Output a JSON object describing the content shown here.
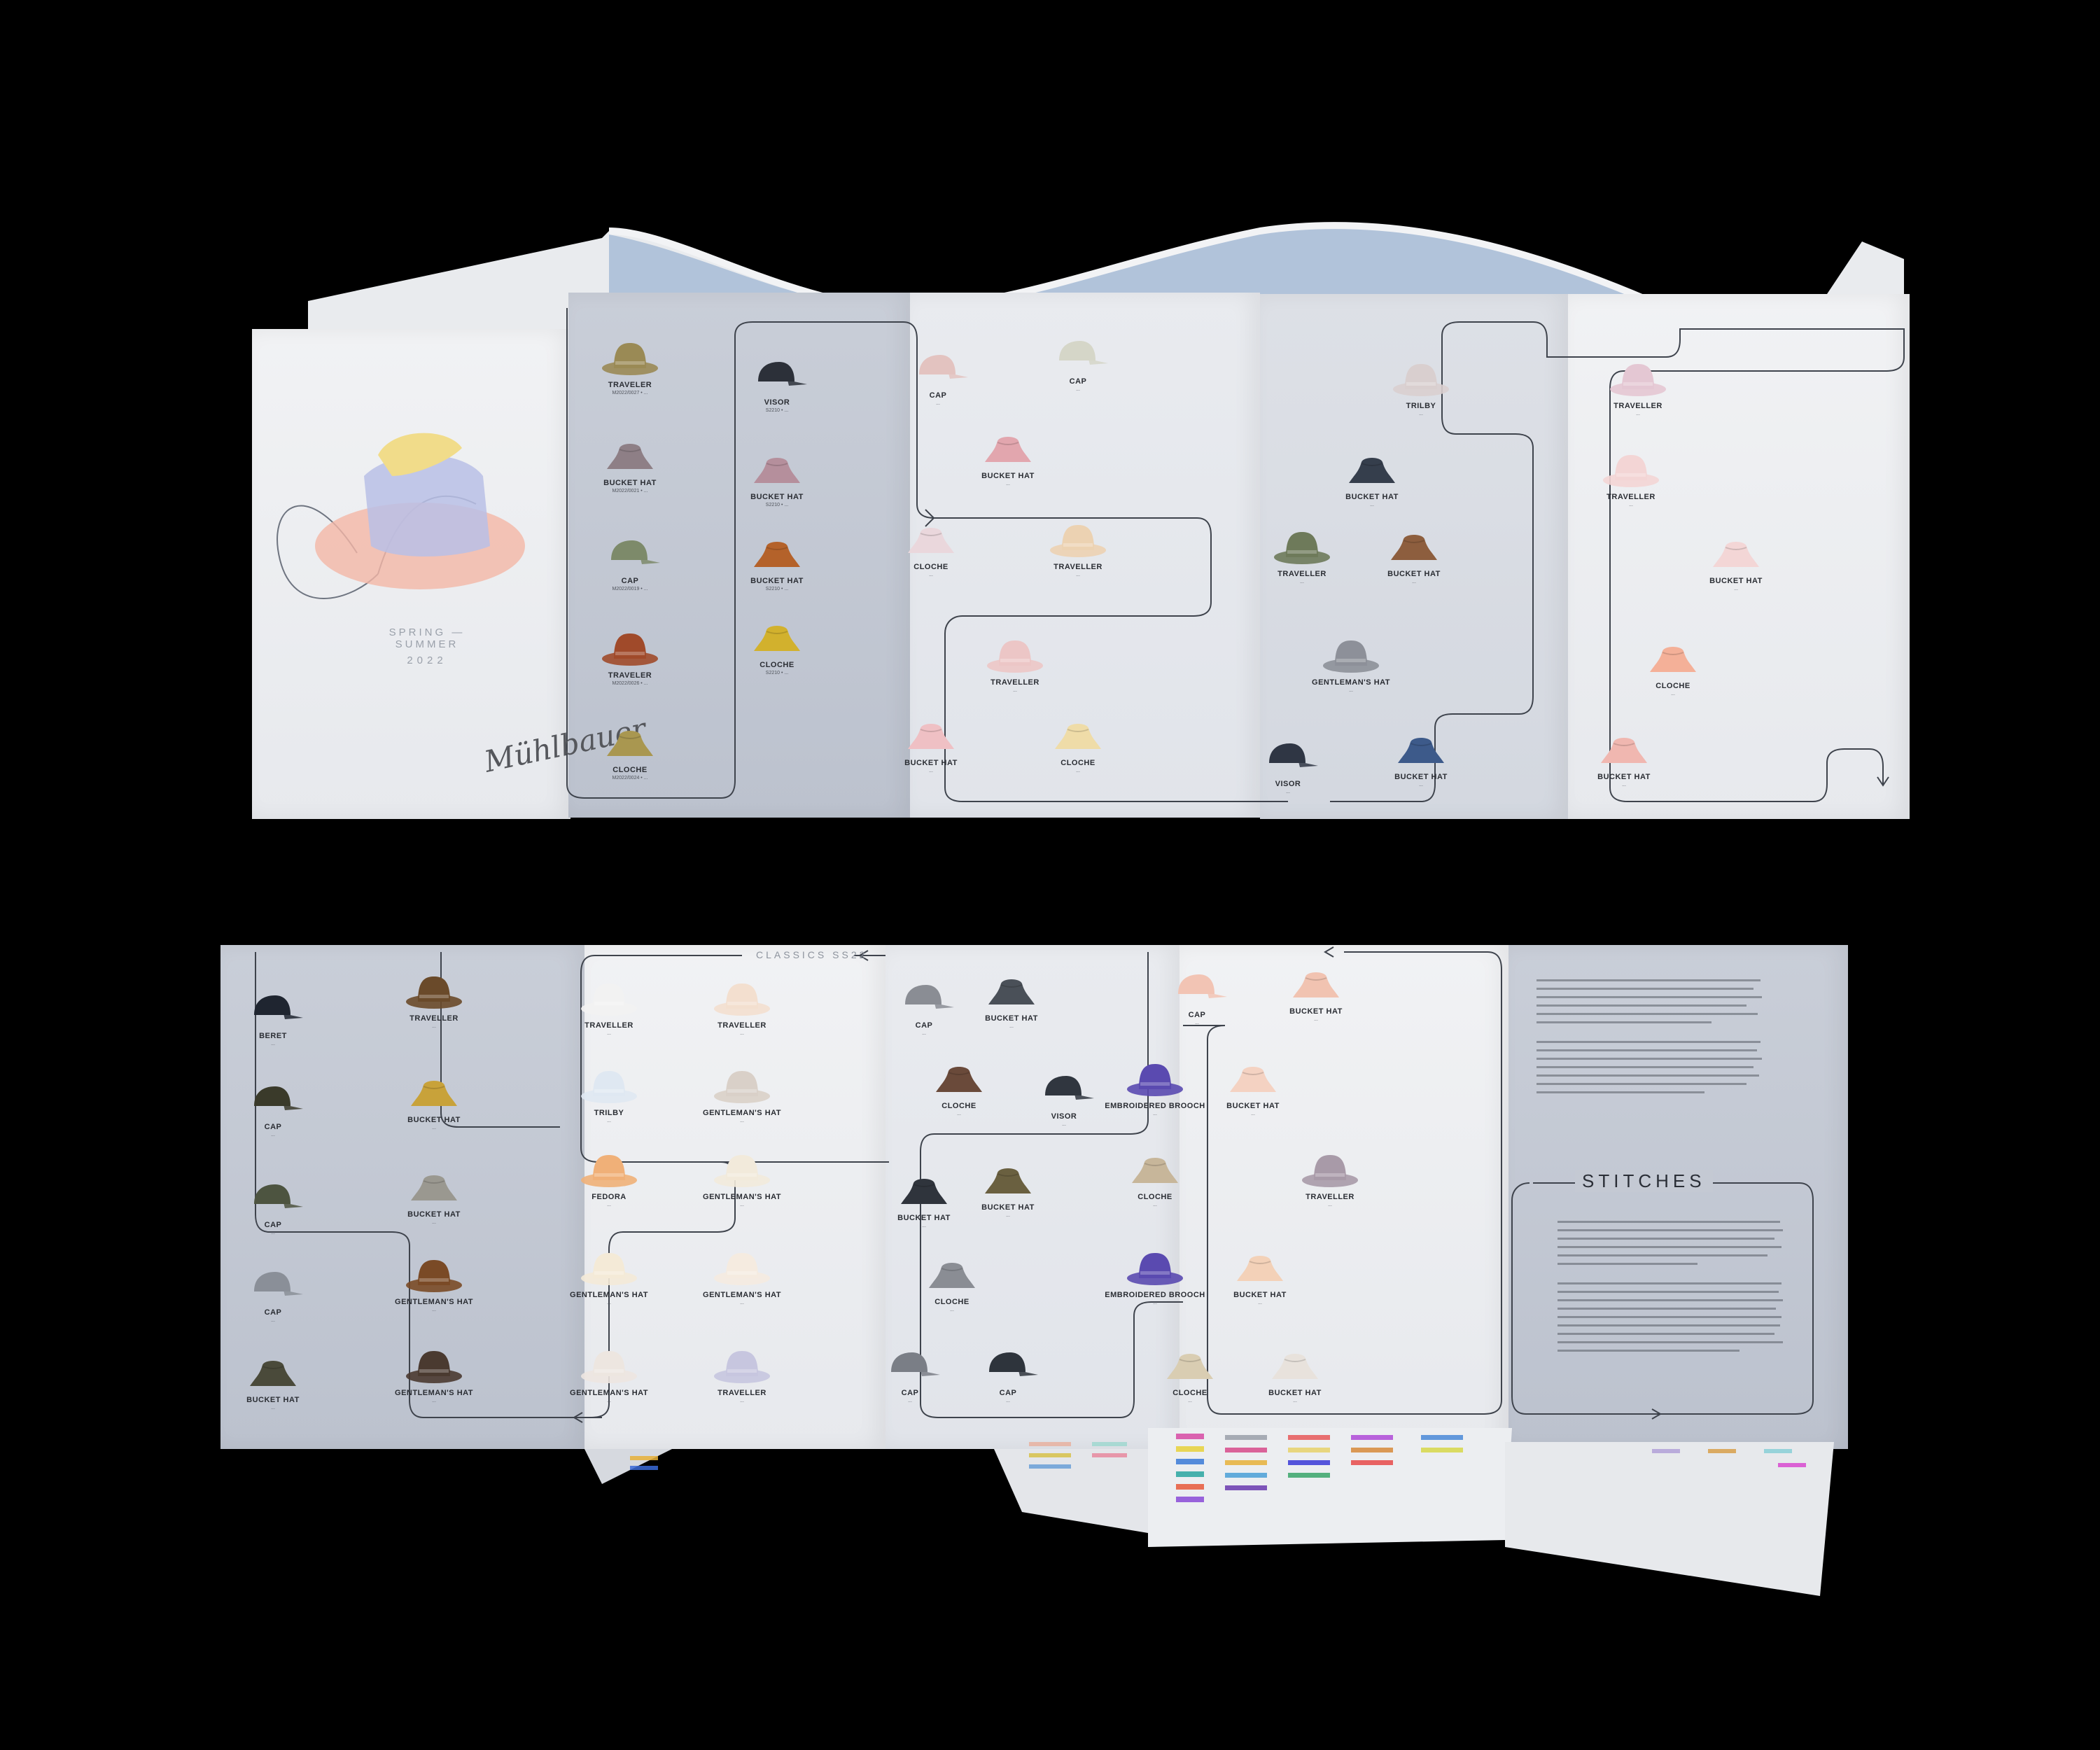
{
  "brand": {
    "logo": "Mühlbauer"
  },
  "cover": {
    "season": "SPRING — SUMMER",
    "year": "2022"
  },
  "classics_heading": "CLASSICS SS22",
  "stitches_heading": "STITCHES",
  "colors": {
    "background": "#000000",
    "paper": "#e6e8ec",
    "paper_shadow": "#c3c8d2",
    "cover_peach": "#f4b6a6",
    "cover_lavender": "#b9bfe6",
    "cover_yellow": "#f1dc8a",
    "backwave_blue": "#9fb8d6"
  },
  "top_hats": [
    {
      "name": "TRAVELER",
      "code": "M2022/0027 • ...",
      "color": "#9a8a55"
    },
    {
      "name": "BUCKET HAT",
      "code": "M2022/0021 • ...",
      "color": "#8e7f86"
    },
    {
      "name": "CAP",
      "code": "M2022/0019 • ...",
      "color": "#7d8a6a"
    },
    {
      "name": "TRAVELER",
      "code": "M2022/0026 • ...",
      "color": "#a04a2a"
    },
    {
      "name": "CLOCHE",
      "code": "M2022/0024 • ...",
      "color": "#a99750"
    },
    {
      "name": "VISOR",
      "code": "S2210 • ...",
      "color": "#2c3039"
    },
    {
      "name": "BUCKET HAT",
      "code": "S2210 • ...",
      "color": "#b58f9c"
    },
    {
      "name": "BUCKET HAT",
      "code": "S2210 • ...",
      "color": "#b4622a"
    },
    {
      "name": "CLOCHE",
      "code": "S2210 • ...",
      "color": "#d2b12d"
    },
    {
      "name": "CAP",
      "code": "...",
      "color": "#e3c3c0"
    },
    {
      "name": "CAP",
      "code": "...",
      "color": "#d5d6c8"
    },
    {
      "name": "BUCKET HAT",
      "code": "...",
      "color": "#e2a6ae"
    },
    {
      "name": "CLOCHE",
      "code": "...",
      "color": "#ead7dc"
    },
    {
      "name": "TRAVELLER",
      "code": "...",
      "color": "#ecd2b2"
    },
    {
      "name": "TRAVELLER",
      "code": "...",
      "color": "#ecc6c6"
    },
    {
      "name": "BUCKET HAT",
      "code": "...",
      "color": "#efc0c4"
    },
    {
      "name": "CLOCHE",
      "code": "...",
      "color": "#efdca8"
    },
    {
      "name": "TRILBY",
      "code": "...",
      "color": "#d9cfcf"
    },
    {
      "name": "BUCKET HAT",
      "code": "...",
      "color": "#353e4c"
    },
    {
      "name": "TRAVELLER",
      "code": "...",
      "color": "#6e7a5a"
    },
    {
      "name": "BUCKET HAT",
      "code": "...",
      "color": "#8d5e3e"
    },
    {
      "name": "GENTLEMAN'S HAT",
      "code": "...",
      "color": "#8d9099"
    },
    {
      "name": "VISOR",
      "code": "...",
      "color": "#2f3644"
    },
    {
      "name": "BUCKET HAT",
      "code": "...",
      "color": "#3d5a8a"
    },
    {
      "name": "TRAVELLER",
      "code": "...",
      "color": "#e4c7d3"
    },
    {
      "name": "TRAVELLER",
      "code": "...",
      "color": "#f3d5d5"
    },
    {
      "name": "BUCKET HAT",
      "code": "...",
      "color": "#f3d6d6"
    },
    {
      "name": "CLOCHE",
      "code": "...",
      "color": "#f4b098"
    },
    {
      "name": "BUCKET HAT",
      "code": "...",
      "color": "#f0b7b0"
    }
  ],
  "bottom_hats": [
    {
      "name": "BERET",
      "code": "...",
      "color": "#1f2530"
    },
    {
      "name": "CAP",
      "code": "...",
      "color": "#3a3a2a"
    },
    {
      "name": "CAP",
      "code": "...",
      "color": "#4d5440"
    },
    {
      "name": "CAP",
      "code": "...",
      "color": "#8a8f98"
    },
    {
      "name": "BUCKET HAT",
      "code": "...",
      "color": "#4a4a3a"
    },
    {
      "name": "TRAVELLER",
      "code": "...",
      "color": "#6a4a2a"
    },
    {
      "name": "BUCKET HAT",
      "code": "...",
      "color": "#c8a23a"
    },
    {
      "name": "BUCKET HAT",
      "code": "...",
      "color": "#9a9890"
    },
    {
      "name": "GENTLEMAN'S HAT",
      "code": "...",
      "color": "#7a4a26"
    },
    {
      "name": "GENTLEMAN'S HAT",
      "code": "...",
      "color": "#4a3a30"
    },
    {
      "name": "TRAVELLER",
      "code": "...",
      "color": "#f2f2f2"
    },
    {
      "name": "TRAVELLER",
      "code": "...",
      "color": "#f3dfcf"
    },
    {
      "name": "TRILBY",
      "code": "...",
      "color": "#dfe8f2"
    },
    {
      "name": "GENTLEMAN'S HAT",
      "code": "...",
      "color": "#d9d0c8"
    },
    {
      "name": "FEDORA",
      "code": "...",
      "color": "#f0b078"
    },
    {
      "name": "GENTLEMAN'S HAT",
      "code": "...",
      "color": "#f2eadb"
    },
    {
      "name": "GENTLEMAN'S HAT",
      "code": "...",
      "color": "#f4ead7"
    },
    {
      "name": "GENTLEMAN'S HAT",
      "code": "...",
      "color": "#f5ebe0"
    },
    {
      "name": "GENTLEMAN'S HAT",
      "code": "...",
      "color": "#ede6e0"
    },
    {
      "name": "TRAVELLER",
      "code": "...",
      "color": "#c7c6df"
    },
    {
      "name": "CAP",
      "code": "...",
      "color": "#8a8d94"
    },
    {
      "name": "BUCKET HAT",
      "code": "...",
      "color": "#4a5058"
    },
    {
      "name": "CLOCHE",
      "code": "...",
      "color": "#6a4a3a"
    },
    {
      "name": "VISOR",
      "code": "...",
      "color": "#30363f"
    },
    {
      "name": "BUCKET HAT",
      "code": "...",
      "color": "#2f343c"
    },
    {
      "name": "BUCKET HAT",
      "code": "...",
      "color": "#6a6040"
    },
    {
      "name": "CLOCHE",
      "code": "...",
      "color": "#8a8d94"
    },
    {
      "name": "CAP",
      "code": "...",
      "color": "#7a7e86"
    },
    {
      "name": "CAP",
      "code": "...",
      "color": "#2e343c"
    },
    {
      "name": "CAP",
      "code": "...",
      "color": "#f2c4b4"
    },
    {
      "name": "BUCKET HAT",
      "code": "...",
      "color": "#f1c3b1"
    },
    {
      "name": "EMBROIDERED BROOCH",
      "code": "...",
      "color": "#5a4ab0"
    },
    {
      "name": "BUCKET HAT",
      "code": "...",
      "color": "#f4d2c2"
    },
    {
      "name": "CLOCHE",
      "code": "...",
      "color": "#c7b69a"
    },
    {
      "name": "TRAVELLER",
      "code": "...",
      "color": "#a89aa8"
    },
    {
      "name": "EMBROIDERED BROOCH",
      "code": "...",
      "color": "#5a4ab0"
    },
    {
      "name": "BUCKET HAT",
      "code": "...",
      "color": "#f3d1b8"
    },
    {
      "name": "CLOCHE",
      "code": "...",
      "color": "#d9cdb2"
    },
    {
      "name": "BUCKET HAT",
      "code": "...",
      "color": "#e8e2dc"
    }
  ]
}
